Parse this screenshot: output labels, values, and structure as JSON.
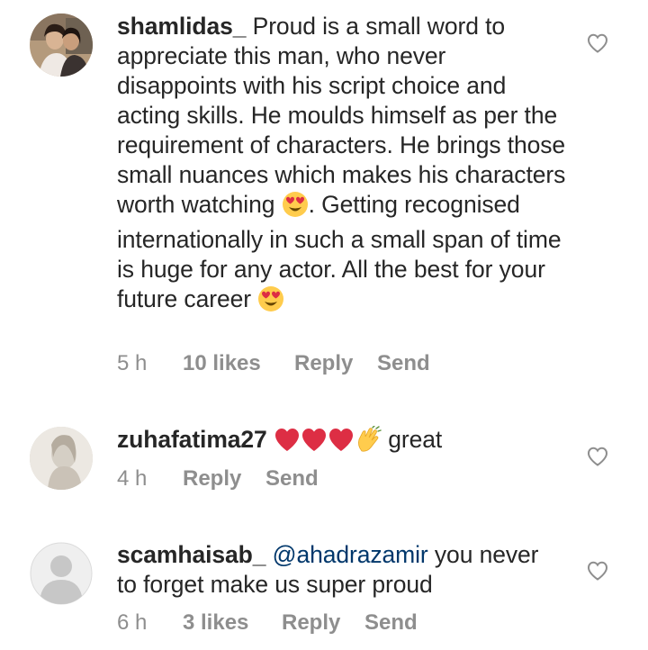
{
  "comments": [
    {
      "username": "shamlidas_",
      "text_parts": [
        "Proud is a small word to appreciate this man, who never disappoints with his script choice and acting skills. He moulds himself as per the requirement of characters. He brings those small nuances which makes his characters worth watching ",
        ". Getting recognised internationally in such a small span of time is huge for any actor. All the best for your future career "
      ],
      "emoji_name": "smiling-face-with-heart-eyes",
      "time": "5 h",
      "likes": "10 likes",
      "reply_label": "Reply",
      "send_label": "Send",
      "avatar": "profile-photo-couple",
      "like_icon": "heart-outline-icon"
    },
    {
      "username": "zuhafatima27",
      "emojis": [
        "red-heart",
        "red-heart",
        "red-heart",
        "clapping-hands"
      ],
      "text": "great",
      "time": "4 h",
      "reply_label": "Reply",
      "send_label": "Send",
      "avatar": "profile-photo-blurred",
      "like_icon": "heart-outline-icon"
    },
    {
      "username": "scamhaisab_",
      "mention": "@ahadrazamir",
      "text": " you never to forget make us super proud",
      "time": "6 h",
      "likes": "3 likes",
      "reply_label": "Reply",
      "send_label": "Send",
      "avatar": "default-avatar",
      "like_icon": "heart-outline-icon"
    }
  ],
  "colors": {
    "text": "#262626",
    "meta": "#8e8e8e",
    "mention": "#00376b",
    "heart_emoji": "#dd2e44",
    "emoji_face": "#ffcc4d"
  }
}
